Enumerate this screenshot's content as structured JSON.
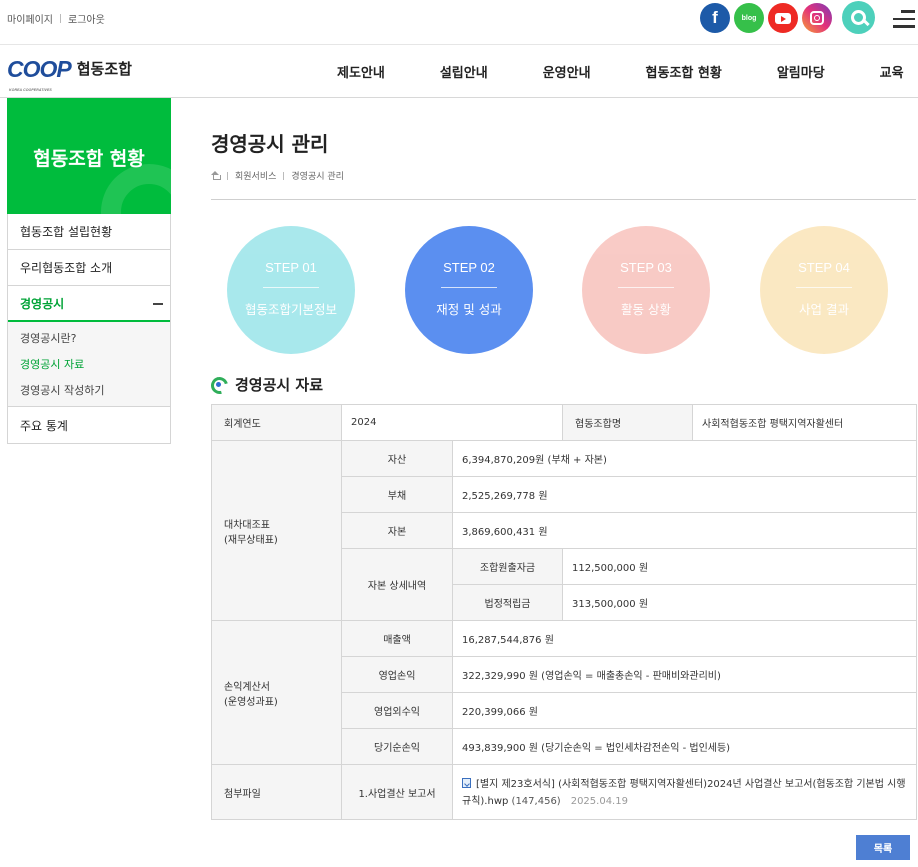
{
  "top_links": {
    "mypage": "마이페이지",
    "logout": "로그아웃"
  },
  "social": {
    "facebook": "f",
    "blog": "blog"
  },
  "logo": {
    "mark": "COOP",
    "sub": "KOREA COOPERATIVES",
    "name": "협동조합"
  },
  "gnb": [
    "제도안내",
    "설립안내",
    "운영안내",
    "협동조합 현황",
    "알림마당",
    "교육"
  ],
  "sidebar": {
    "title": "협동조합 현황",
    "items": [
      "협동조합 설립현황",
      "우리협동조합 소개",
      "경영공시"
    ],
    "sub_items": [
      "경영공시란?",
      "경영공시 자료",
      "경영공시 작성하기"
    ],
    "last_item": "주요 통계"
  },
  "page": {
    "title": "경영공시 관리",
    "breadcrumb": [
      "회원서비스",
      "경영공시 관리"
    ],
    "section_title": "경영공시 자료",
    "list_button": "목록"
  },
  "steps": [
    {
      "label": "STEP 01",
      "name": "협동조합기본정보",
      "color": "#6fd9e0",
      "active": false
    },
    {
      "label": "STEP 02",
      "name": "재정 및 성과",
      "color": "#5b8ff0",
      "active": true
    },
    {
      "label": "STEP 03",
      "name": "활동 상황",
      "color": "#f5a8a0",
      "active": false
    },
    {
      "label": "STEP 04",
      "name": "사업 결과",
      "color": "#f8d99a",
      "active": false
    }
  ],
  "table": {
    "fiscal_year_label": "회계연도",
    "fiscal_year": "2024",
    "coop_name_label": "협동조합명",
    "coop_name": "사회적협동조합 평택지역자활센터",
    "balance_sheet_label_1": "대차대조표",
    "balance_sheet_label_2": "(재무상태표)",
    "assets_label": "자산",
    "assets": "6,394,870,209원 (부채 + 자본)",
    "liabilities_label": "부채",
    "liabilities": "2,525,269,778 원",
    "equity_label": "자본",
    "equity": "3,869,600,431 원",
    "equity_detail_label": "자본 상세내역",
    "paid_in_label": "조합원출자금",
    "paid_in": "112,500,000 원",
    "legal_reserve_label": "법정적립금",
    "legal_reserve": "313,500,000 원",
    "income_label_1": "손익계산서",
    "income_label_2": "(운영성과표)",
    "revenue_label": "매출액",
    "revenue": "16,287,544,876 원",
    "operating_label": "영업손익",
    "operating": "322,329,990 원 (영업손익 = 매출총손익 - 판매비와관리비)",
    "non_operating_label": "영업외수익",
    "non_operating": "220,399,066 원",
    "net_label": "당기순손익",
    "net": "493,839,900 원 (당기순손익 = 법인세차감전손익 - 법인세등)",
    "attachment_label": "첨부파일",
    "attachment_type": "1.사업결산 보고서",
    "attachment_name": "[별지 제23호서식] (사회적협동조합 평택지역자활센터)2024년 사업결산 보고서(협동조합 기본법 시행규칙).hwp",
    "attachment_size": "(147,456)",
    "attachment_date": "2025.04.19"
  }
}
